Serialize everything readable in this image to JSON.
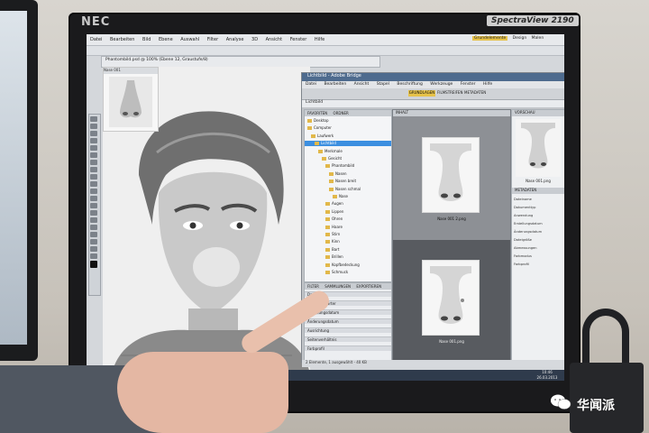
{
  "monitor": {
    "brand": "NEC",
    "model_badge": "SpectraView 2190"
  },
  "photoshop": {
    "menu": [
      "Datei",
      "Bearbeiten",
      "Bild",
      "Ebene",
      "Auswahl",
      "Filter",
      "Analyse",
      "3D",
      "Ansicht",
      "Fenster",
      "Hilfe"
    ],
    "top_right": [
      "Grundelemente",
      "Design",
      "Malen"
    ],
    "document_tab": "Phantombild.psd @ 100% (Ebene 12, Graustufe/8)",
    "nose_panel_title": "Nase 001"
  },
  "bridge": {
    "title": "Lichtbild - Adobe Bridge",
    "menu": [
      "Datei",
      "Bearbeiten",
      "Ansicht",
      "Stapel",
      "Beschriftung",
      "Werkzeuge",
      "Fenster",
      "Hilfe"
    ],
    "workspaces": [
      "GRUNDLAGEN",
      "FILMSTREIFEN",
      "METADATEN"
    ],
    "path": "Lichtbild",
    "folder_tabs": [
      "FAVORITEN",
      "ORDNER"
    ],
    "folders": [
      "Desktop",
      "Computer",
      "Laufwerk",
      "Lichtbild",
      "Merkmale",
      "Gesicht",
      "Phantombild",
      "Nasen",
      "Nasen breit",
      "Nasen schmal",
      "Nase",
      "Augen",
      "Lippen",
      "Ohren",
      "Haare",
      "Stirn",
      "Kinn",
      "Bart",
      "Brillen",
      "Kopfbedeckung",
      "Schmuck"
    ],
    "selected_folder": "Lichtbild",
    "filter_tabs": [
      "FILTER",
      "SAMMLUNGEN",
      "EXPORTIEREN"
    ],
    "filters": [
      "Dateityp",
      "Schlüsselwörter",
      "Erstellungsdatum",
      "Änderungsdatum",
      "Ausrichtung",
      "Seitenverhältnis",
      "Farbprofil"
    ],
    "content_tab": "INHALT",
    "thumbnails": [
      {
        "label": "Nase 001 2.png",
        "selected": false
      },
      {
        "label": "Nase 001.png",
        "selected": true
      }
    ],
    "preview_tab": "VORSCHAU",
    "preview_caption": "Nase 001.png",
    "metadata_tab": "METADATEN",
    "metadata": [
      "Dateiname",
      "Dokumenttyp",
      "Anwendung",
      "Erstellungsdatum",
      "Änderungsdatum",
      "Dateigröße",
      "Abmessungen",
      "Farbmodus",
      "Farbprofil"
    ],
    "status": "2 Elemente, 1 ausgewählt - 40 KB"
  },
  "taskbar": {
    "time": "10:46",
    "date": "26.03.2013"
  },
  "watermark": {
    "text": "华闻派"
  }
}
